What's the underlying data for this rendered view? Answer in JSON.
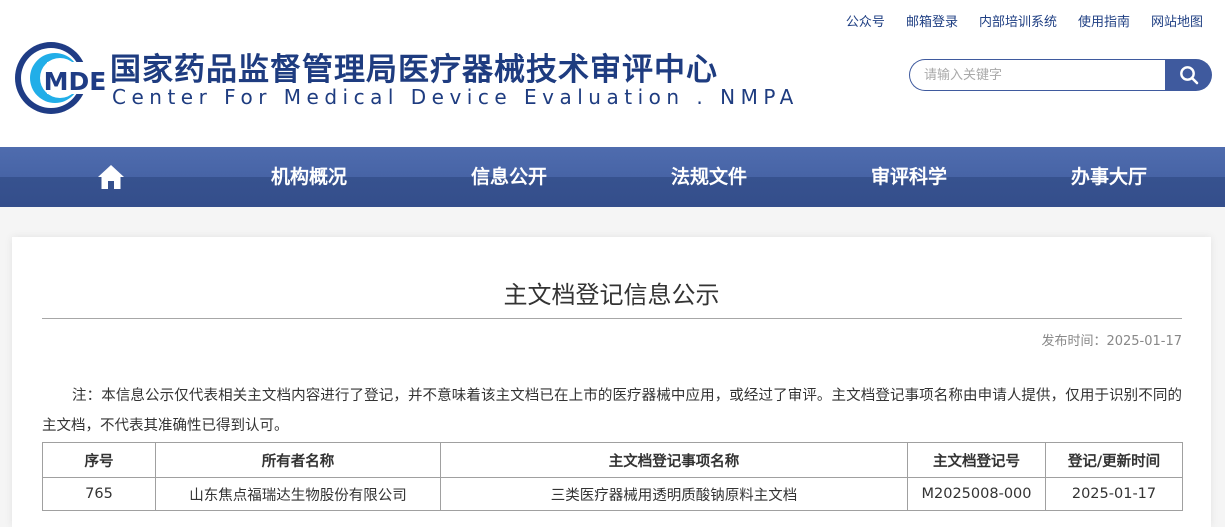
{
  "header": {
    "top_links": [
      "公众号",
      "邮箱登录",
      "内部培训系统",
      "使用指南",
      "网站地图"
    ],
    "logo_text": "MDE",
    "title_cn": "国家药品监督管理局医疗器械技术审评中心",
    "title_en": "Center For Medical Device Evaluation . NMPA",
    "search_placeholder": "请输入关键字",
    "brand_color": "#1e3c80",
    "accent_color": "#3f5a9e"
  },
  "nav": {
    "home_icon": "home-icon",
    "items": [
      "机构概况",
      "信息公开",
      "法规文件",
      "审评科学",
      "办事大厅"
    ]
  },
  "article": {
    "title": "主文档登记信息公示",
    "publish_date": "发布时间：2025-01-17",
    "note": "注：本信息公示仅代表相关主文档内容进行了登记，并不意味着该主文档已在上市的医疗器械中应用，或经过了审评。主文档登记事项名称由申请人提供，仅用于识别不同的主文档，不代表其准确性已得到认可。"
  },
  "table": {
    "headers": [
      "序号",
      "所有者名称",
      "主文档登记事项名称",
      "主文档登记号",
      "登记/更新时间"
    ],
    "rows": [
      [
        "765",
        "山东焦点福瑞达生物股份有限公司",
        "三类医疗器械用透明质酸钠原料主文档",
        "M2025008-000",
        "2025-01-17"
      ]
    ]
  }
}
